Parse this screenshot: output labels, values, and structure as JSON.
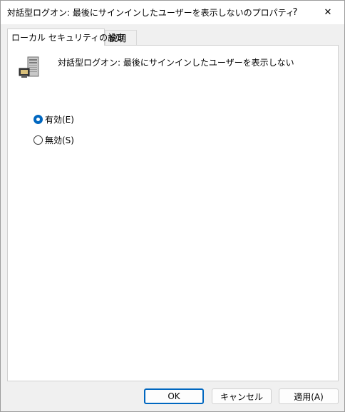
{
  "window": {
    "title": "対話型ログオン: 最後にサインインしたユーザーを表示しないのプロパティ",
    "help_glyph": "?",
    "close_glyph": "✕"
  },
  "tabs": [
    {
      "label": "ローカル セキュリティの設定",
      "active": true
    },
    {
      "label": "説明",
      "active": false
    }
  ],
  "policy": {
    "icon": "server-computer-icon",
    "name": "対話型ログオン: 最後にサインインしたユーザーを表示しない"
  },
  "options": [
    {
      "label": "有効(E)",
      "checked": true
    },
    {
      "label": "無効(S)",
      "checked": false
    }
  ],
  "buttons": {
    "ok": "OK",
    "cancel": "キャンセル",
    "apply": "適用(A)"
  },
  "colors": {
    "accent": "#0067c0",
    "dialog_background": "#f0f0f0"
  }
}
